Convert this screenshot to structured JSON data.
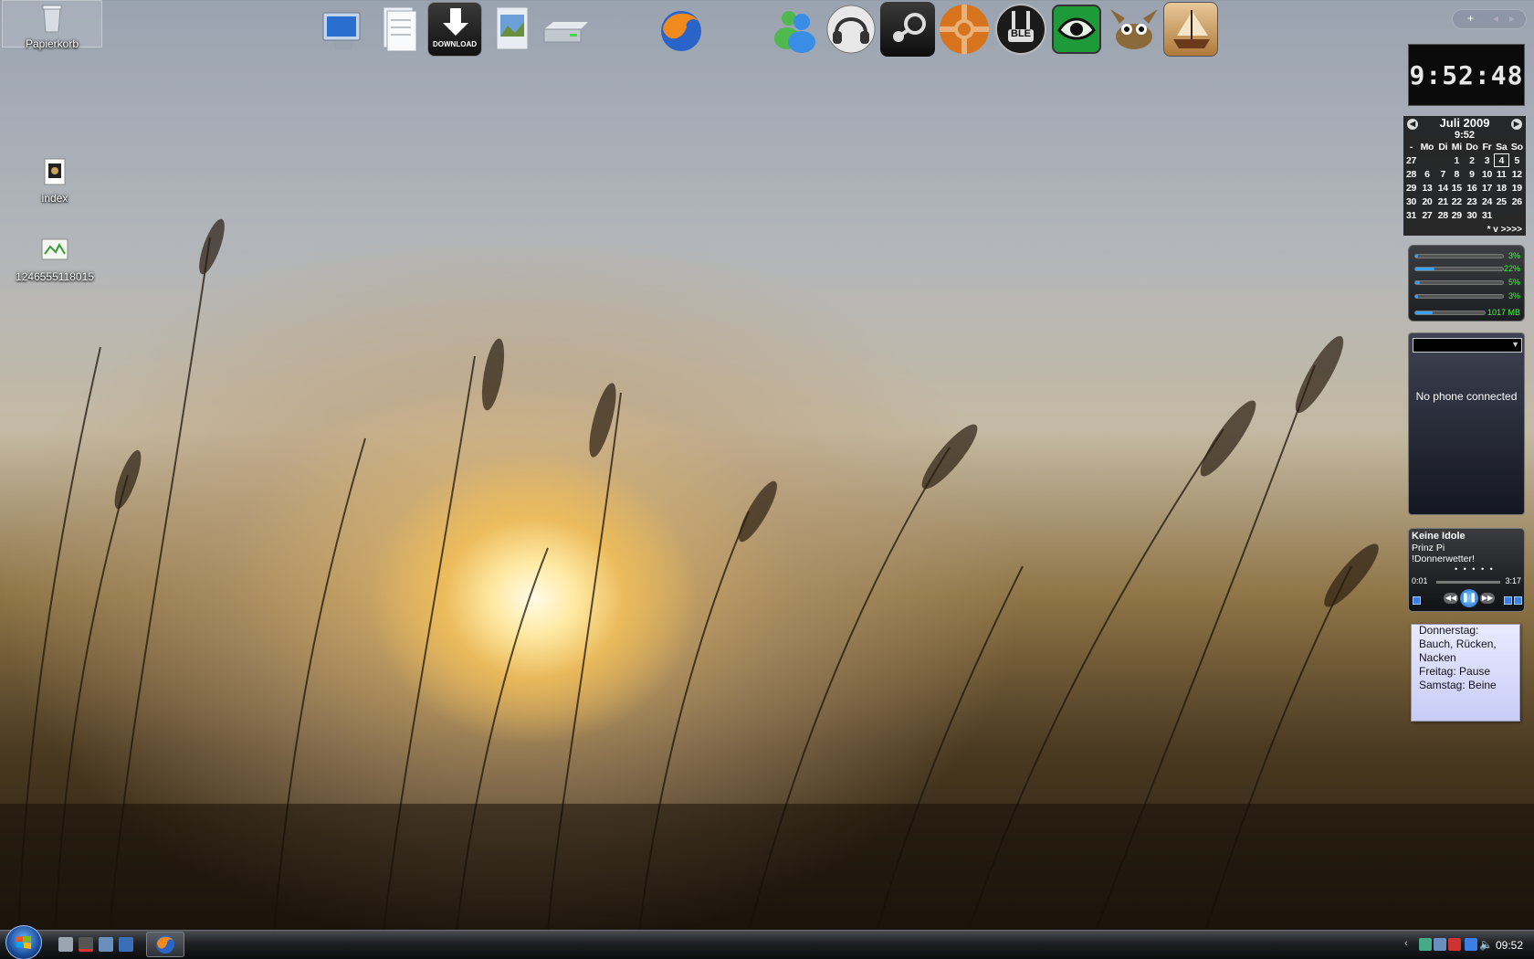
{
  "desktop": {
    "icons": [
      {
        "label": "Papierkorb",
        "icon": "recycle-bin-icon"
      },
      {
        "label": "index",
        "icon": "image-file-icon"
      },
      {
        "label": "1246555118015",
        "icon": "image-file-icon"
      }
    ]
  },
  "dock": {
    "items": [
      {
        "icon": "computer-icon"
      },
      {
        "icon": "documents-icon"
      },
      {
        "icon": "download-icon",
        "label": "DOWNLOAD"
      },
      {
        "icon": "pictures-icon"
      },
      {
        "icon": "drive-icon"
      },
      {
        "icon": "firefox-icon"
      },
      {
        "icon": "messenger-icon"
      },
      {
        "icon": "headphones-icon"
      },
      {
        "icon": "steam-icon"
      },
      {
        "icon": "tf2-icon"
      },
      {
        "icon": "ble-icon",
        "label": "BLE"
      },
      {
        "icon": "eye-icon"
      },
      {
        "icon": "gimp-icon"
      },
      {
        "icon": "ship-game-icon"
      }
    ]
  },
  "sidebar": {
    "controls": {
      "add": "+",
      "prev": "◂",
      "next": "▸"
    },
    "clock": {
      "time": "9:52:48"
    },
    "calendar": {
      "month": "Juli 2009",
      "time": "9:52",
      "weekday_headers": [
        "-",
        "Mo",
        "Di",
        "Mi",
        "Do",
        "Fr",
        "Sa",
        "So"
      ],
      "weeks": [
        [
          "27",
          "",
          "",
          "1",
          "2",
          "3",
          "4",
          "5"
        ],
        [
          "28",
          "6",
          "7",
          "8",
          "9",
          "10",
          "11",
          "12"
        ],
        [
          "29",
          "13",
          "14",
          "15",
          "16",
          "17",
          "18",
          "19"
        ],
        [
          "30",
          "20",
          "21",
          "22",
          "23",
          "24",
          "25",
          "26"
        ],
        [
          "31",
          "27",
          "28",
          "29",
          "30",
          "31",
          "",
          ""
        ]
      ],
      "today": "4",
      "footer": "* v >>>>"
    },
    "meters": [
      {
        "value": "3%",
        "fraction": 0.03
      },
      {
        "value": "22%",
        "fraction": 0.22
      },
      {
        "value": "5%",
        "fraction": 0.05
      },
      {
        "value": "3%",
        "fraction": 0.03
      },
      {
        "value": "1017 MB",
        "fraction": 0.25
      }
    ],
    "phone": {
      "message": "No phone connected"
    },
    "media": {
      "title": "Keine Idole",
      "artist": "Prinz Pi",
      "album": "!Donnerwetter!",
      "rating": "• • • • •",
      "current": "0:01",
      "total": "3:17"
    },
    "note": {
      "lines": [
        "Donnerstag:",
        "Bauch, Rücken,",
        "Nacken",
        "Freitag: Pause",
        "Samstag: Beine"
      ]
    }
  },
  "taskbar": {
    "start": "start-orb",
    "clock": "09:52"
  }
}
